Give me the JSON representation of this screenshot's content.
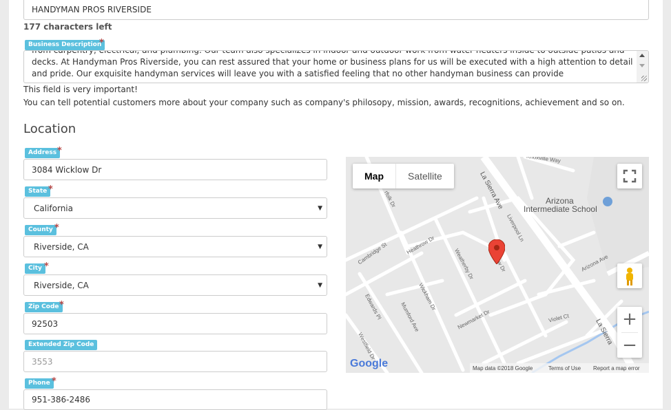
{
  "business_name": {
    "value": "HANDYMAN PROS RIVERSIDE",
    "chars_left": "177 characters left"
  },
  "business_description": {
    "label": "Business Description",
    "lines": [
      "from carpentry, electrical, and plumbing. Our team also specializes in indoor and outdoor work from water heaters inside to outside patios and",
      "decks. At Handyman Pros Riverside, you can rest assured that your home or business plans for us will be executed with a high attention to detail",
      "and pride. Our exquisite handyman services will leave you with a satisfied feeling that no other handyman business can provide"
    ],
    "note": "This field is very important!",
    "help": "You can tell potential customers more about your company such as company's philosopy, mission, awards, recognitions, achievement and so on."
  },
  "location": {
    "heading": "Location",
    "address": {
      "label": "Address",
      "value": "3084 Wicklow Dr"
    },
    "state": {
      "label": "State",
      "value": "California"
    },
    "county": {
      "label": "County",
      "value": "Riverside, CA"
    },
    "city": {
      "label": "City",
      "value": "Riverside, CA"
    },
    "zip": {
      "label": "Zip Code",
      "value": "92503"
    },
    "ext_zip": {
      "label": "Extended Zip Code",
      "placeholder": "3553"
    },
    "phone": {
      "label": "Phone",
      "value": "951-386-2486"
    }
  },
  "required_mark": "*",
  "map": {
    "type_map": "Map",
    "type_satellite": "Satellite",
    "zoom_in": "+",
    "zoom_out": "−",
    "google": "Google",
    "map_data": "Map data ©2018 Google",
    "terms": "Terms of Use",
    "report": "Report a map error",
    "place": {
      "line1": "Arizona",
      "line2": "Intermediate School"
    },
    "streets": {
      "la_sierra_ave": "La Sierra Ave",
      "la_sierra_ave_2": "La Sierra",
      "knoxville_way": "Knoxville Way",
      "liverpool_ln": "Liverpool Ln",
      "cambridge_st": "Cambridge St",
      "heathrow_dr": "Heathrow Dr",
      "weatherby_dr": "Weatherby Dr",
      "wicklow_dr": "ow Dr",
      "wickham_dr": "Wickham Dr",
      "newmarket_dr": "Newmarket Dr",
      "edwards_pl": "Edwards Pl",
      "mumford_ave": "Mumford Ave",
      "westfield_dr": "Westfield Dr",
      "violet_ct": "Violet Ct",
      "arizona_ave": "Arizona Ave",
      "norfolk_dr": "rfolk Dr"
    }
  },
  "colors": {
    "label_bg": "#5bc0de",
    "required": "#b94a48",
    "pin": "#ea4335"
  }
}
